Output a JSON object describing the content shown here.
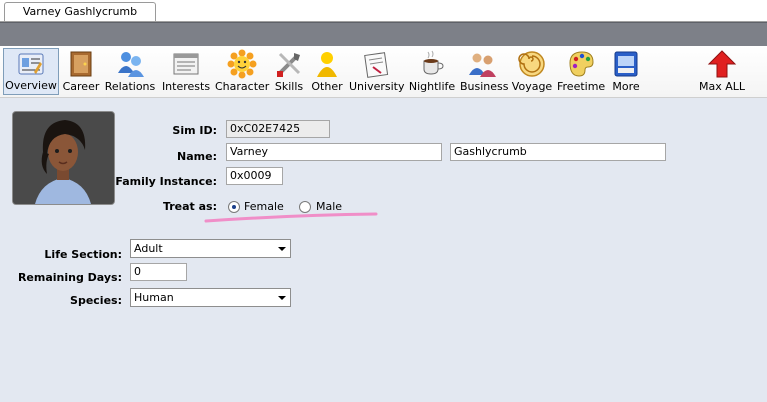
{
  "tab": {
    "title": "Varney Gashlycrumb"
  },
  "toolbar": {
    "items": [
      {
        "label": "Overview",
        "icon": "overview-icon"
      },
      {
        "label": "Career",
        "icon": "career-icon"
      },
      {
        "label": "Relations",
        "icon": "relations-icon"
      },
      {
        "label": "Interests",
        "icon": "interests-icon"
      },
      {
        "label": "Character",
        "icon": "character-icon"
      },
      {
        "label": "Skills",
        "icon": "skills-icon"
      },
      {
        "label": "Other",
        "icon": "other-icon"
      },
      {
        "label": "University",
        "icon": "university-icon"
      },
      {
        "label": "Nightlife",
        "icon": "nightlife-icon"
      },
      {
        "label": "Business",
        "icon": "business-icon"
      },
      {
        "label": "Voyage",
        "icon": "voyage-icon"
      },
      {
        "label": "Freetime",
        "icon": "freetime-icon"
      },
      {
        "label": "More",
        "icon": "more-icon"
      },
      {
        "label": "Max ALL",
        "icon": "max-all-icon"
      }
    ],
    "active": "Overview"
  },
  "form": {
    "sim_id_label": "Sim ID:",
    "sim_id_value": "0xC02E7425",
    "name_label": "Name:",
    "first_name": "Varney",
    "last_name": "Gashlycrumb",
    "family_label": "Family Instance:",
    "family_value": "0x0009",
    "treat_as_label": "Treat as:",
    "female_label": "Female",
    "male_label": "Male",
    "selected_gender": "Female",
    "life_section_label": "Life Section:",
    "life_section_value": "Adult",
    "remaining_days_label": "Remaining Days:",
    "remaining_days_value": "0",
    "species_label": "Species:",
    "species_value": "Human"
  },
  "colors": {
    "accent_underline": "#f08ec8",
    "panel_bg": "#e3e8f1",
    "band": "#7d8088"
  }
}
